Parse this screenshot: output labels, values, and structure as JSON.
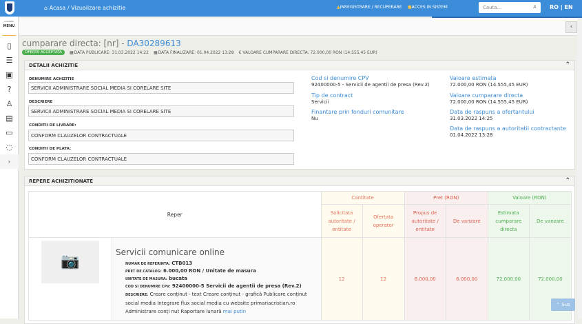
{
  "topbar": {
    "home": "Acasa",
    "separator": "/",
    "current": "Vizualizare achizitie",
    "register": "INREGISTRARE / RECUPERARE",
    "login": "ACCES IN SISTEM",
    "search_placeholder": "Cauta...",
    "lang_ro": "RO",
    "lang_sep": "|",
    "lang_en": "EN"
  },
  "sidebar": {
    "brand": "e-licitatie",
    "menu": "MENU",
    "expand": "›"
  },
  "title": {
    "prefix": "cumparare directa: [nr] - ",
    "code": "DA30289613",
    "status": "OFERTA ACCEPTATA",
    "publish": "DATA PUBLICARE: 31.03.2022 14:22",
    "finish": "DATA FINALIZARE: 01.04.2022 13:28",
    "value": "€ VALOARE CUMPARARE DIRECTA: 72.000,00  RON (14.555,45  EUR)"
  },
  "details": {
    "heading": "DETALII ACHIZITIE",
    "fields": [
      {
        "label": "DENUMIRE ACHIZITIE",
        "value": "SERVICII ADMINISTRARE SOCIAL MEDIA SI CORELARE SITE"
      },
      {
        "label": "DESCRIERE",
        "value": "SERVICII ADMINISTRARE SOCIAL MEDIA SI CORELARE SITE"
      },
      {
        "label": "CONDITII DE LIVRARE:",
        "value": "CONFORM CLAUZELOR CONTRACTUALE"
      },
      {
        "label": "CONDITII DE PLATA:",
        "value": "CONFORM CLAUZELOR CONTRACTUALE"
      }
    ],
    "info_mid": [
      {
        "label": "Cod si denumire CPV",
        "value": "92400000-5 - Servicii de agentii de presa (Rev.2)"
      },
      {
        "label": "Tip de contract",
        "value": "Servicii"
      },
      {
        "label": "Finantare prin fonduri comunitare",
        "value": "Nu"
      }
    ],
    "info_right": [
      {
        "label": "Valoare estimata",
        "value": "72.000,00  RON (14.555,45  EUR)"
      },
      {
        "label": "Valoare cumparare directa",
        "value": "72.000,00  RON (14.555,45  EUR)"
      },
      {
        "label": "Data de raspuns a ofertantului",
        "value": "31.03.2022 14:25"
      },
      {
        "label": "Data de raspuns a autoritatii contractante",
        "value": "01.04.2022 13:28"
      }
    ]
  },
  "repere": {
    "heading": "REPERE ACHIZITIONATE",
    "headers": {
      "reper": "Reper",
      "cantitate": "Cantitate",
      "pret": "Pret (RON)",
      "valoare": "Valoare (RON)",
      "solicitata": "Solicitata autoritate / entitate",
      "ofertata": "Ofertata operator",
      "propus": "Propus de autoritate / entitate",
      "de_vanzare_pret": "De vanzare",
      "estimata": "Estimata cumparare directa",
      "de_vanzare_val": "De vanzare"
    },
    "item": {
      "name": "Servicii comunicare online",
      "ref_label": "NUMAR DE REFERINTA:",
      "ref": "CTB013",
      "catalog_label": "PRET DE CATALOG:",
      "catalog": "6.000,00  RON / Unitate de masura",
      "unit_label": "UNITATE DE MASURA:",
      "unit": "bucata",
      "cpv_label": "COD SI DENUMIRE CPV:",
      "cpv": "92400000-5 Servicii de agentii de presa (Rev.2)",
      "desc_label": "DESCRIERE:",
      "desc": "Creare conținut - text Creare conținut - grafică Publicare conținut social media Integrare flux social media cu website primariacristian.ro Administrare conți nut Raportare lunară",
      "less": "mai putin",
      "solicitata": "12",
      "ofertata": "12",
      "propus": "6.000,00",
      "de_vanzare_pret": "6.000,00",
      "estimata": "72.000,00",
      "de_vanzare_val": "72.000,00"
    }
  },
  "back_to_top": "Sus"
}
